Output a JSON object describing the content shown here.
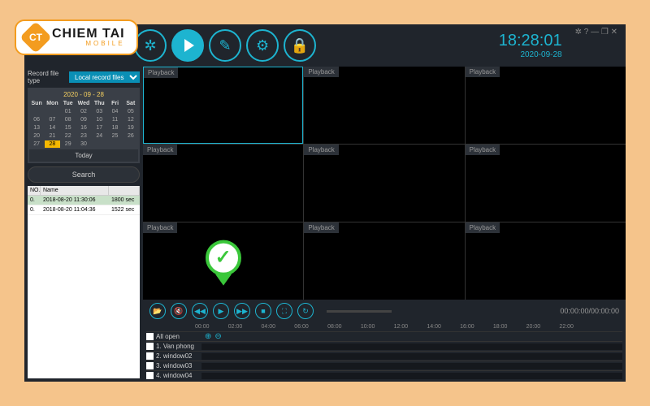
{
  "watermark": {
    "badge": "CT",
    "main": "CHIEM TAI",
    "sub": "MOBILE"
  },
  "app": {
    "logo": "cms",
    "clock": {
      "time": "18:28:01",
      "date": "2020-09-28"
    },
    "sidebar": {
      "filetype_label": "Record file type",
      "filetype_value": "Local record files",
      "cal_title": "2020 - 09 - 28",
      "cal_days": [
        "Sun",
        "Mon",
        "Tue",
        "Wed",
        "Thu",
        "Fri",
        "Sat"
      ],
      "cal_cells": [
        "",
        "",
        "01",
        "02",
        "03",
        "04",
        "05",
        "06",
        "07",
        "08",
        "09",
        "10",
        "11",
        "12",
        "13",
        "14",
        "15",
        "16",
        "17",
        "18",
        "19",
        "20",
        "21",
        "22",
        "23",
        "24",
        "25",
        "26",
        "27",
        "28",
        "29",
        "30",
        "",
        "",
        ""
      ],
      "cal_selected": "28",
      "today": "Today",
      "search": "Search",
      "list_headers": [
        "NO.",
        "Name",
        ""
      ],
      "list_rows": [
        {
          "no": "0.",
          "name": "2018-08-20  11:30:06",
          "dur": "1800 sec"
        },
        {
          "no": "0.",
          "name": "2018-08-20  11:04:36",
          "dur": "1522 sec"
        }
      ]
    },
    "grid": {
      "label": "Playback"
    },
    "controls": {
      "timestamp": "00:00:00/00:00:00"
    },
    "timeline": {
      "scale": [
        "00:00",
        "02:00",
        "04:00",
        "06:00",
        "08:00",
        "10:00",
        "12:00",
        "14:00",
        "16:00",
        "18:00",
        "20:00",
        "22:00"
      ],
      "rows": [
        "All open",
        "1. Van phong",
        "2. window02",
        "3. window03",
        "4. window04"
      ]
    }
  }
}
